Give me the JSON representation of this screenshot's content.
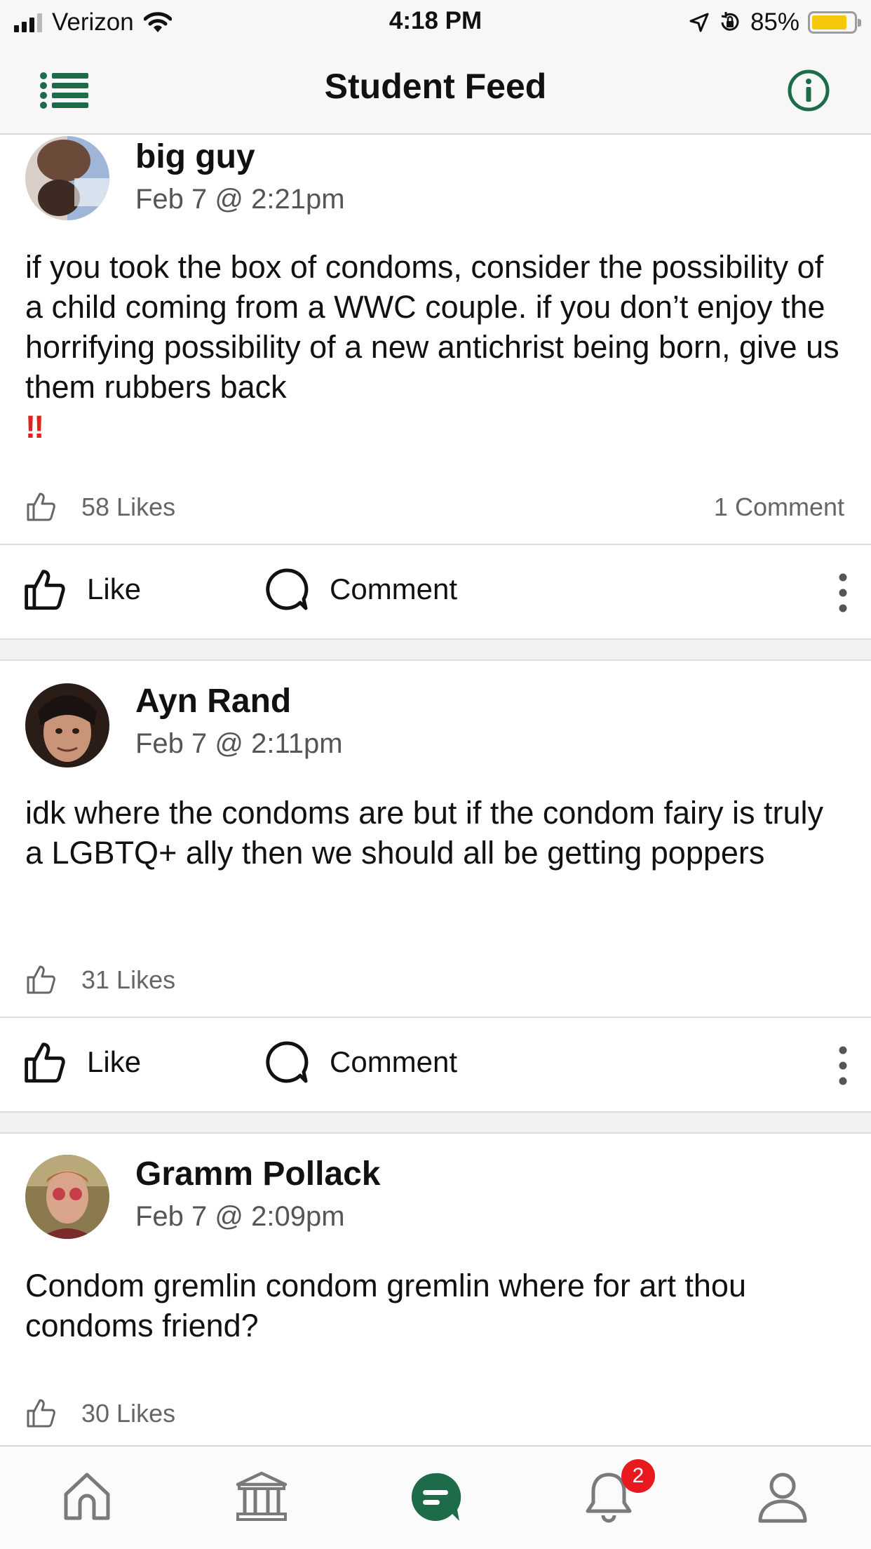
{
  "status_bar": {
    "carrier": "Verizon",
    "time": "4:18 PM",
    "battery": "85%",
    "battery_level": 0.85,
    "icons": [
      "signal-icon",
      "wifi-icon",
      "location-icon",
      "orientation-lock-icon",
      "battery-icon"
    ]
  },
  "nav": {
    "title": "Student Feed",
    "left_icon": "menu-list-icon",
    "right_icon": "info-icon"
  },
  "colors": {
    "accent": "#1e6b4a",
    "badge": "#e8191f",
    "emoji_red": "#e0231b"
  },
  "posts": [
    {
      "author": "big guy",
      "time": "Feb 7 @ 2:21pm",
      "body": "if you took the box of condoms, consider the possibility of a child coming from a WWC couple. if you don’t enjoy the horrifying possibility of a new antichrist being born, give us them rubbers back",
      "emoji": "‼",
      "likes": "58 Likes",
      "comments": "1 Comment",
      "like_label": "Like",
      "comment_label": "Comment"
    },
    {
      "author": "Ayn Rand",
      "time": "Feb 7 @ 2:11pm",
      "body": "idk where the condoms are but if the condom fairy is truly a LGBTQ+ ally then we should all be getting poppers",
      "likes": "31 Likes",
      "like_label": "Like",
      "comment_label": "Comment"
    },
    {
      "author": "Gramm Pollack",
      "time": "Feb 7 @ 2:09pm",
      "body": "Condom gremlin condom gremlin where for art thou condoms friend?",
      "likes": "30 Likes"
    }
  ],
  "tab_bar": {
    "tabs": [
      "home-icon",
      "institution-icon",
      "feed-icon",
      "notifications-icon",
      "profile-icon"
    ],
    "active": "feed-icon",
    "notification_badge": "2"
  }
}
